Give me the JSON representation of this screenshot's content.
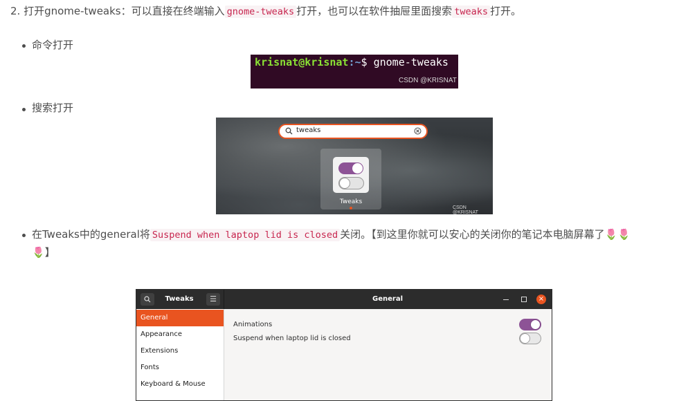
{
  "step2": {
    "prefix": "2. 打开gnome-tweaks：可以直接在终端输入",
    "code1": "gnome-tweaks",
    "middle": "打开，也可以在软件抽屉里面搜索",
    "code2": "tweaks",
    "suffix": "打开。"
  },
  "bullet_command": "命令打开",
  "terminal": {
    "user": "krisnat@krisnat",
    "path": ":~",
    "dollar": "$ ",
    "command": "gnome-tweaks",
    "watermark": "CSDN @KRISNAT"
  },
  "bullet_search": "搜索打开",
  "search_shot": {
    "query": "tweaks",
    "app_label": "Tweaks",
    "watermark": "CSDN @KRISNAT"
  },
  "bullet_general": {
    "prefix": "在Tweaks中的general将",
    "code": "Suspend when laptop lid is closed",
    "suffix": "关闭。【到这里你就可以安心的关闭你的笔记本电脑屏幕了",
    "emoji": "🌷",
    "end": "】"
  },
  "tweaks_window": {
    "app_title": "Tweaks",
    "panel_title": "General",
    "sidebar": [
      "General",
      "Appearance",
      "Extensions",
      "Fonts",
      "Keyboard & Mouse"
    ],
    "settings": [
      {
        "label": "Animations",
        "enabled": true
      },
      {
        "label": "Suspend when laptop lid is closed",
        "enabled": false
      }
    ],
    "accent": "#e95420",
    "toggle_on": "#8d5396"
  }
}
